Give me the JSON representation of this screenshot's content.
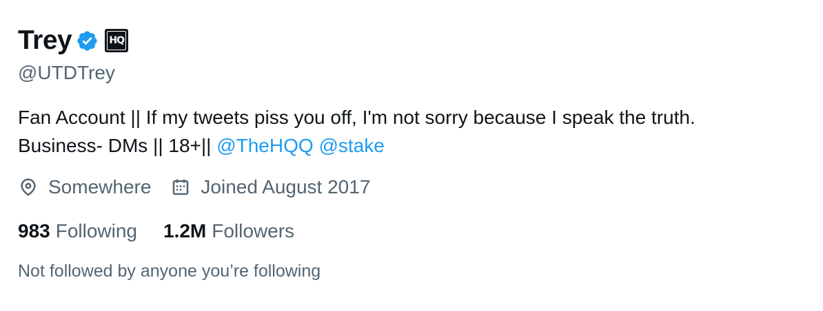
{
  "profile": {
    "display_name": "Trey",
    "handle": "@UTDTrey",
    "affiliate_badge_text": "HQ",
    "verified_icon": "verified-badge-icon",
    "verified_color": "#1d9bf0",
    "bio": {
      "line1": "Fan Account || If my tweets piss you off, I'm not sorry because I speak the truth.",
      "line2_text": "Business- DMs || 18+|| ",
      "mention1": "@TheHQQ",
      "mention2": "@stake"
    },
    "location": "Somewhere",
    "location_icon": "location-pin-icon",
    "joined": "Joined August 2017",
    "joined_icon": "calendar-icon",
    "following_count": "983",
    "following_label": "Following",
    "followers_count": "1.2M",
    "followers_label": "Followers",
    "followed_by_note": "Not followed by anyone you’re following"
  },
  "colors": {
    "text_primary": "#0f1419",
    "text_secondary": "#536471",
    "link": "#1d9bf0"
  }
}
